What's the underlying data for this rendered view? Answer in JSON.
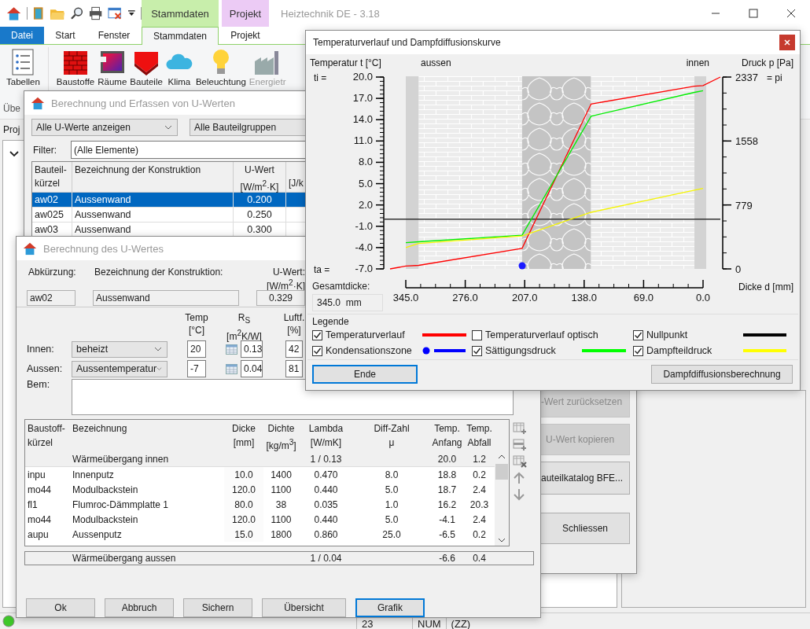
{
  "app": {
    "title": "Heiztechnik DE - 3.18",
    "contextual_tabs": [
      {
        "label": "Stammdaten",
        "color": "#c8eeab"
      },
      {
        "label": "Projekt",
        "color": "#eccbf5"
      }
    ],
    "ribbon_tabs": [
      {
        "label": "Datei",
        "kind": "file",
        "selected": false
      },
      {
        "label": "Start",
        "kind": "tab",
        "selected": false
      },
      {
        "label": "Fenster",
        "kind": "tab",
        "selected": false
      },
      {
        "label": "Stammdaten",
        "kind": "tab",
        "selected": true
      },
      {
        "label": "Projekt",
        "kind": "tab",
        "selected": false
      }
    ],
    "ribbon_items": [
      {
        "label": "Tabellen",
        "kind": "list",
        "disabled": false
      },
      {
        "label": "Baustoffe",
        "kind": "bricks",
        "disabled": false
      },
      {
        "label": "Räume",
        "kind": "room",
        "disabled": false
      },
      {
        "label": "Bauteile",
        "kind": "slab",
        "disabled": false
      },
      {
        "label": "Klima",
        "kind": "cloud",
        "disabled": false
      },
      {
        "label": "Beleuchtung",
        "kind": "bulb",
        "disabled": false
      },
      {
        "label": "Energietr",
        "kind": "factory",
        "disabled": true
      }
    ],
    "group_label": "Übe",
    "panel_label": "Proj"
  },
  "dialog_a": {
    "title": "Berechnung und Erfassen von U-Werten",
    "view_select": "Alle U-Werte anzeigen",
    "group_select": "Alle Bauteilgruppen",
    "filter_label": "Filter:",
    "filter_value": "(Alle Elemente)",
    "columns": [
      {
        "lines": [
          "Bauteil-",
          "kürzel"
        ]
      },
      {
        "lines": [
          "Bezeichnung der Konstruktion"
        ]
      },
      {
        "lines": [
          "U-Wert",
          "[W/m$^{2}$·K]"
        ]
      },
      {
        "lines": [
          "[J/k"
        ]
      }
    ],
    "rows": [
      {
        "cells": [
          "aw02",
          "Aussenwand",
          "0.200"
        ],
        "selected": true
      },
      {
        "cells": [
          "aw025",
          "Aussenwand",
          "0.250"
        ],
        "selected": false
      },
      {
        "cells": [
          "aw03",
          "Aussenwand",
          "0.300"
        ],
        "selected": false
      }
    ],
    "side_buttons": [
      {
        "label": "-Wert zurücksetzen",
        "disabled": true
      },
      {
        "label": "U-Wert kopieren",
        "disabled": true
      },
      {
        "label": "auteilkatalog BFE...",
        "disabled": false
      },
      {
        "label": "Schliessen",
        "disabled": false
      }
    ]
  },
  "dialog_b": {
    "title": "Berechnung des U-Wertes",
    "abbr_label": "Abkürzung:",
    "name_label": "Bezeichnung der Konstruktion:",
    "uwert_label": "U-Wert:",
    "uwert_unit": "[W/m$^{2}$·K]",
    "abbr": "aw02",
    "name": "Aussenwand",
    "uwert": "0.329",
    "condition_headers": [
      {
        "title": "Temp",
        "unit": "[°C]"
      },
      {
        "title": "R$_{S}$",
        "unit": "[m$^{2}$K/W]"
      },
      {
        "title": "Luftf.",
        "unit": "[%]"
      }
    ],
    "conditions": [
      {
        "label": "Innen:",
        "select": "beheizt",
        "temp": "20",
        "rs": "0.13",
        "humidity": "42"
      },
      {
        "label": "Aussen:",
        "select": "Aussentemperatur",
        "temp": "-7",
        "rs": "0.04",
        "humidity": "81"
      }
    ],
    "remark_label": "Bem:",
    "columns": [
      {
        "lines": [
          "Baustoff-",
          "kürzel"
        ]
      },
      {
        "lines": [
          "Bezeichnung"
        ]
      },
      {
        "lines": [
          "Dicke",
          "[mm]"
        ]
      },
      {
        "lines": [
          "Dichte",
          "[kg/m$^{3}$]"
        ]
      },
      {
        "lines": [
          "Lambda",
          "[W/mK]"
        ]
      },
      {
        "lines": [
          "Diff-Zahl",
          "μ"
        ]
      },
      {
        "lines": [
          "Temp.",
          "Anfang"
        ]
      },
      {
        "lines": [
          "Temp.",
          "Abfall"
        ]
      }
    ],
    "rows": [
      {
        "kind": "transfer",
        "name": "Wärmeübergang innen",
        "lambda": "1 / 0.13",
        "temp_start": "20.0",
        "temp_drop": "1.2"
      },
      {
        "kind": "layer",
        "code": "inpu",
        "name": "Innenputz",
        "thickness": "10.0",
        "density": "1400",
        "lambda": "0.470",
        "mu": "8.0",
        "temp_start": "18.8",
        "temp_drop": "0.2"
      },
      {
        "kind": "layer",
        "code": "mo44",
        "name": "Modulbackstein",
        "thickness": "120.0",
        "density": "1100",
        "lambda": "0.440",
        "mu": "5.0",
        "temp_start": "18.7",
        "temp_drop": "2.4"
      },
      {
        "kind": "layer",
        "code": "fl1",
        "name": "Flumroc-Dämmplatte 1",
        "thickness": "80.0",
        "density": "38",
        "lambda": "0.035",
        "mu": "1.0",
        "temp_start": "16.2",
        "temp_drop": "20.3"
      },
      {
        "kind": "layer",
        "code": "mo44",
        "name": "Modulbackstein",
        "thickness": "120.0",
        "density": "1100",
        "lambda": "0.440",
        "mu": "5.0",
        "temp_start": "-4.1",
        "temp_drop": "2.4"
      },
      {
        "kind": "layer",
        "code": "aupu",
        "name": "Aussenputz",
        "thickness": "15.0",
        "density": "1800",
        "lambda": "0.860",
        "mu": "25.0",
        "temp_start": "-6.5",
        "temp_drop": "0.2"
      }
    ],
    "footer_row": {
      "name": "Wärmeübergang aussen",
      "lambda": "1 / 0.04",
      "temp_start": "-6.6",
      "temp_drop": "0.4"
    },
    "buttons": [
      {
        "label": "Ok",
        "focused": false
      },
      {
        "label": "Abbruch",
        "focused": false
      },
      {
        "label": "Sichern",
        "focused": false
      },
      {
        "label": "Übersicht",
        "focused": false
      },
      {
        "label": "Grafik",
        "focused": true
      }
    ]
  },
  "chart_window": {
    "title": "Temperaturverlauf und Dampfdiffusionskurve",
    "outside_label": "aussen",
    "inside_label": "innen",
    "right_axis_title": "Druck p [Pa]",
    "ti_label": "ti =",
    "ta_label": "ta =",
    "pi_label": "= pi",
    "total_label": "Gesamtdicke:",
    "total_value": "345.0  mm",
    "chart_data": {
      "type": "line",
      "xlabel": "Dicke d [mm]",
      "ylabel": "Temperatur t [°C]",
      "x": [
        345,
        330,
        210,
        130,
        10,
        0
      ],
      "xlim": [
        345,
        0
      ],
      "ylim": [
        -7,
        20
      ],
      "y2lim": [
        0,
        2337
      ],
      "xticks": [
        {
          "value": 345,
          "label": "345.0"
        },
        {
          "value": 276,
          "label": "276.0"
        },
        {
          "value": 207,
          "label": "207.0"
        },
        {
          "value": 138,
          "label": "138.0"
        },
        {
          "value": 69,
          "label": "69.0"
        },
        {
          "value": 0,
          "label": "0.0"
        }
      ],
      "yticks": [
        {
          "value": 20,
          "label": "20.0"
        },
        {
          "value": 17,
          "label": "17.0"
        },
        {
          "value": 14,
          "label": "14.0"
        },
        {
          "value": 11,
          "label": "11.0"
        },
        {
          "value": 8,
          "label": "8.0"
        },
        {
          "value": 5,
          "label": "5.0"
        },
        {
          "value": 2,
          "label": "2.0"
        },
        {
          "value": -1,
          "label": "-1.0"
        },
        {
          "value": -4,
          "label": "-4.0"
        },
        {
          "value": -7,
          "label": "-7.0"
        }
      ],
      "y2ticks": [
        0,
        779,
        1558,
        2337
      ],
      "series": [
        {
          "color": "#ff0000",
          "values": [
            -6.6,
            -6.5,
            -4.1,
            16.2,
            18.7,
            18.8
          ]
        },
        {
          "color": "#00ee00",
          "axis": "y2",
          "values": [
            320,
            330,
            410,
            1860,
            2150,
            2170
          ]
        },
        {
          "color": "#f5f500",
          "axis": "y2",
          "values": [
            260,
            310,
            400,
            690,
            960,
            980
          ]
        }
      ]
    },
    "legend_title": "Legende",
    "legend": [
      {
        "label": "Temperaturverlauf",
        "checked": true,
        "kind": "line",
        "color": "#ff0000"
      },
      {
        "label": "Temperaturverlauf optisch",
        "checked": false,
        "kind": "none"
      },
      {
        "label": "Nullpunkt",
        "checked": true,
        "kind": "line",
        "color": "#000000"
      },
      {
        "label": "Kondensationszone",
        "checked": true,
        "kind": "dot-line",
        "color": "#0000ff"
      },
      {
        "label": "Sättigungsdruck",
        "checked": true,
        "kind": "line",
        "color": "#00ff00"
      },
      {
        "label": "Dampfteildruck",
        "checked": true,
        "kind": "line",
        "color": "#ffff00"
      }
    ],
    "buttons": [
      {
        "label": "Ende",
        "focused": true
      },
      {
        "label": "Dampfdiffusionsberechnung",
        "focused": false
      }
    ]
  },
  "status_bar": {
    "cells": [
      "23",
      "NUM",
      "(ZZ)"
    ]
  }
}
